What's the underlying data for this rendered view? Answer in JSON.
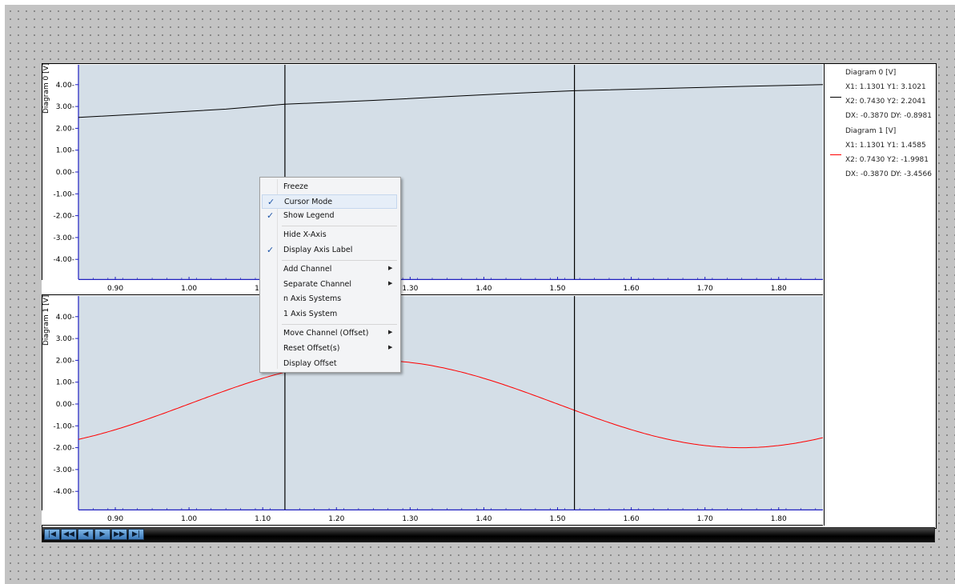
{
  "chart_data": [
    {
      "type": "line",
      "ylabel": "Diagram 0 [V]",
      "xlim": [
        0.85,
        1.86
      ],
      "ylim": [
        -4.9,
        4.9
      ],
      "x_ticks": [
        "0.90",
        "1.00",
        "1.10",
        "1.20",
        "1.30",
        "1.40",
        "1.50",
        "1.60",
        "1.70",
        "1.80"
      ],
      "y_ticks": [
        "4.00",
        "3.00",
        "2.00",
        "1.00",
        "0.00",
        "-1.00",
        "-2.00",
        "-3.00",
        "-4.00"
      ],
      "series": [
        {
          "name": "Diagram 0 [V]",
          "color": "#000000",
          "x": [
            0.85,
            0.95,
            1.05,
            1.1301,
            1.25,
            1.35,
            1.45,
            1.5229,
            1.65,
            1.75,
            1.86
          ],
          "y": [
            2.5,
            2.68,
            2.88,
            3.1021,
            3.28,
            3.45,
            3.62,
            3.72,
            3.83,
            3.92,
            4.0
          ]
        }
      ],
      "cursors": [
        1.1301,
        1.5229
      ]
    },
    {
      "type": "line",
      "ylabel": "Diagram 1 [V]",
      "xlim": [
        0.85,
        1.86
      ],
      "ylim": [
        -4.9,
        4.9
      ],
      "x_ticks": [
        "0.90",
        "1.00",
        "1.10",
        "1.20",
        "1.30",
        "1.40",
        "1.50",
        "1.60",
        "1.70",
        "1.80"
      ],
      "y_ticks": [
        "4.00",
        "3.00",
        "2.00",
        "1.00",
        "0.00",
        "-1.00",
        "-2.00",
        "-3.00",
        "-4.00"
      ],
      "series": [
        {
          "name": "Diagram 1 [V]",
          "color": "#ff0000",
          "function": {
            "form": "A*sin(2*pi*(x-x0)/P)",
            "A": 2.0,
            "x0": 1.0,
            "P": 1.0
          }
        }
      ],
      "cursors": [
        1.1301,
        1.5229
      ]
    }
  ],
  "legend": {
    "entries": [
      {
        "title": "Diagram 0 [V]",
        "color": "#000000",
        "lines": [
          "X1: 1.1301 Y1: 3.1021",
          "X2: 0.7430 Y2: 2.2041",
          "DX: -0.3870 DY: -0.8981"
        ]
      },
      {
        "title": "Diagram 1 [V]",
        "color": "#ff0000",
        "lines": [
          "X1: 1.1301 Y1: 1.4585",
          "X2: 0.7430 Y2: -1.9981",
          "DX: -0.3870 DY: -3.4566"
        ]
      }
    ]
  },
  "context_menu": {
    "items": [
      {
        "label": "Freeze",
        "checked": false,
        "submenu": false
      },
      {
        "label": "Cursor Mode",
        "checked": true,
        "submenu": false,
        "highlighted": true
      },
      {
        "label": "Show Legend",
        "checked": true,
        "submenu": false
      },
      {
        "label": "Hide X-Axis",
        "checked": false,
        "submenu": false,
        "separator_before": true
      },
      {
        "label": "Display Axis Label",
        "checked": true,
        "submenu": false
      },
      {
        "label": "Add Channel",
        "checked": false,
        "submenu": true,
        "separator_before": true
      },
      {
        "label": "Separate Channel",
        "checked": false,
        "submenu": true
      },
      {
        "label": "n Axis Systems",
        "checked": false,
        "submenu": false
      },
      {
        "label": "1 Axis System",
        "checked": false,
        "submenu": false
      },
      {
        "label": "Move Channel (Offset)",
        "checked": false,
        "submenu": true,
        "separator_before": true
      },
      {
        "label": "Reset Offset(s)",
        "checked": false,
        "submenu": true
      },
      {
        "label": "Display Offset",
        "checked": false,
        "submenu": false
      }
    ],
    "check_glyph": "✓",
    "arrow_glyph": "▶"
  },
  "playbar": {
    "buttons": [
      {
        "name": "first-icon",
        "glyph": "|◀"
      },
      {
        "name": "rewind-icon",
        "glyph": "◀◀"
      },
      {
        "name": "step-back-icon",
        "glyph": "◀"
      },
      {
        "name": "play-icon",
        "glyph": "▶"
      },
      {
        "name": "fast-forward-icon",
        "glyph": "▶▶"
      },
      {
        "name": "last-icon",
        "glyph": "▶|"
      }
    ]
  }
}
